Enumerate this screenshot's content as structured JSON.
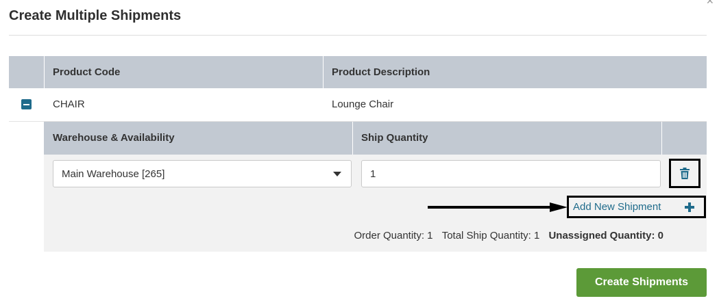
{
  "dialog": {
    "title": "Create Multiple Shipments",
    "close_glyph": "✕"
  },
  "products_table": {
    "headers": [
      "Product Code",
      "Product Description"
    ],
    "rows": [
      {
        "code": "CHAIR",
        "description": "Lounge Chair",
        "expanded": true
      }
    ]
  },
  "shipments_table": {
    "headers": [
      "Warehouse & Availability",
      "Ship Quantity"
    ],
    "rows": [
      {
        "warehouse": "Main Warehouse [265]",
        "ship_quantity": "1"
      }
    ],
    "delete_icon": "trash-icon",
    "add_link_label": "Add New Shipment",
    "add_icon": "plus-icon"
  },
  "totals": {
    "order_quantity": "Order Quantity: 1",
    "total_ship_quantity": "Total Ship Quantity: 1",
    "unassigned_quantity": "Unassigned Quantity: 0"
  },
  "footer": {
    "create_button_label": "Create Shipments"
  },
  "colors": {
    "header_bg": "#c2c9d2",
    "link": "#1f6b8b",
    "primary_button": "#5c9a38",
    "panel_bg": "#f2f2f2"
  }
}
